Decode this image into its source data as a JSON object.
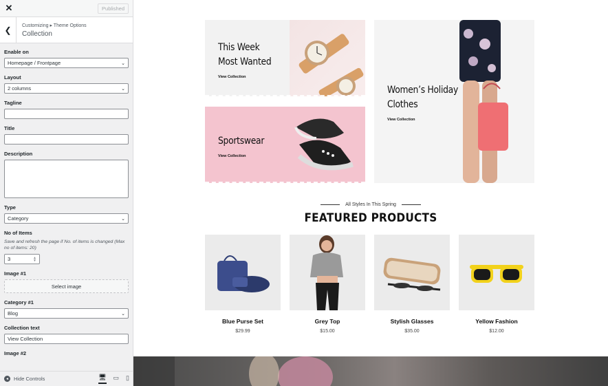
{
  "topbar": {
    "close_icon": "close-icon",
    "published_label": "Published"
  },
  "breadcrumb": {
    "path": "Customizing ▸ Theme Options",
    "title": "Collection"
  },
  "controls": {
    "enable_on": {
      "label": "Enable on",
      "value": "Homepage / Frontpage"
    },
    "layout": {
      "label": "Layout",
      "value": "2 columns"
    },
    "tagline": {
      "label": "Tagline",
      "value": ""
    },
    "title": {
      "label": "Title",
      "value": ""
    },
    "description": {
      "label": "Description",
      "value": ""
    },
    "type": {
      "label": "Type",
      "value": "Category"
    },
    "no_of_items": {
      "label": "No of Items",
      "desc": "Save and refresh the page if No. of items is changed (Max no of items: 20)",
      "value": "3"
    },
    "image1": {
      "label": "Image #1",
      "button": "Select image"
    },
    "category1": {
      "label": "Category #1",
      "value": "Blog"
    },
    "collection_text": {
      "label": "Collection text",
      "value": "View Collection"
    },
    "image2": {
      "label": "Image #2"
    }
  },
  "footer": {
    "hide_controls": "Hide Controls"
  },
  "banners": {
    "watches": {
      "line1": "This Week",
      "line2": "Most Wanted",
      "link": "View Collection"
    },
    "sportswear": {
      "line1": "Sportswear",
      "link": "View Collection"
    },
    "holiday": {
      "line1": "Women’s Holiday",
      "line2": "Clothes",
      "link": "View Collection"
    }
  },
  "featured": {
    "subtitle": "All Styles In This Spring",
    "title": "FEATURED PRODUCTS",
    "products": [
      {
        "name": "Blue Purse Set",
        "price": "$29.99"
      },
      {
        "name": "Grey Top",
        "price": "$15.00"
      },
      {
        "name": "Stylish Glasses",
        "price": "$35.00"
      },
      {
        "name": "Yellow Fashion",
        "price": "$12.00"
      }
    ]
  },
  "colors": {
    "panel_bg": "#f0f0f1",
    "banner_pink": "#f4c4cf",
    "banner_grey": "#f4f4f4",
    "accent_text": "#111111"
  }
}
